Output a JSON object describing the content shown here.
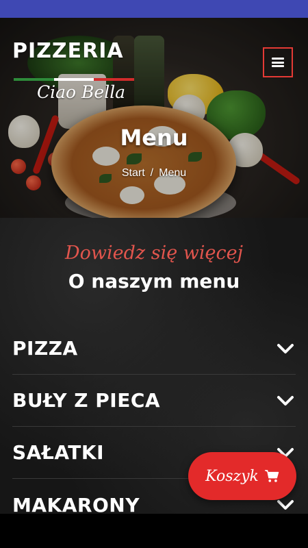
{
  "colors": {
    "status_bar": "#3f48b3",
    "accent_red": "#e32a2a",
    "subtitle_red": "#e2554d",
    "flag_green": "#2e8b3a",
    "flag_white": "#ffffff",
    "flag_red": "#d22b2b"
  },
  "header": {
    "logo_top": "PIZZERIA",
    "logo_script": "Ciao Bella",
    "menu_icon": "hamburger-icon"
  },
  "hero": {
    "title": "Menu",
    "breadcrumb": {
      "home": "Start",
      "separator": "/",
      "current": "Menu"
    }
  },
  "section": {
    "subtitle": "Dowiedz się więcej",
    "title": "O naszym menu"
  },
  "accordion": {
    "chevron_icon": "chevron-down-icon",
    "items": [
      {
        "label": "PIZZA"
      },
      {
        "label": "BUŁY Z PIECA"
      },
      {
        "label": "SAŁATKI"
      },
      {
        "label": "MAKARONY"
      }
    ]
  },
  "cart": {
    "label": "Koszyk",
    "icon": "shopping-cart-icon"
  }
}
